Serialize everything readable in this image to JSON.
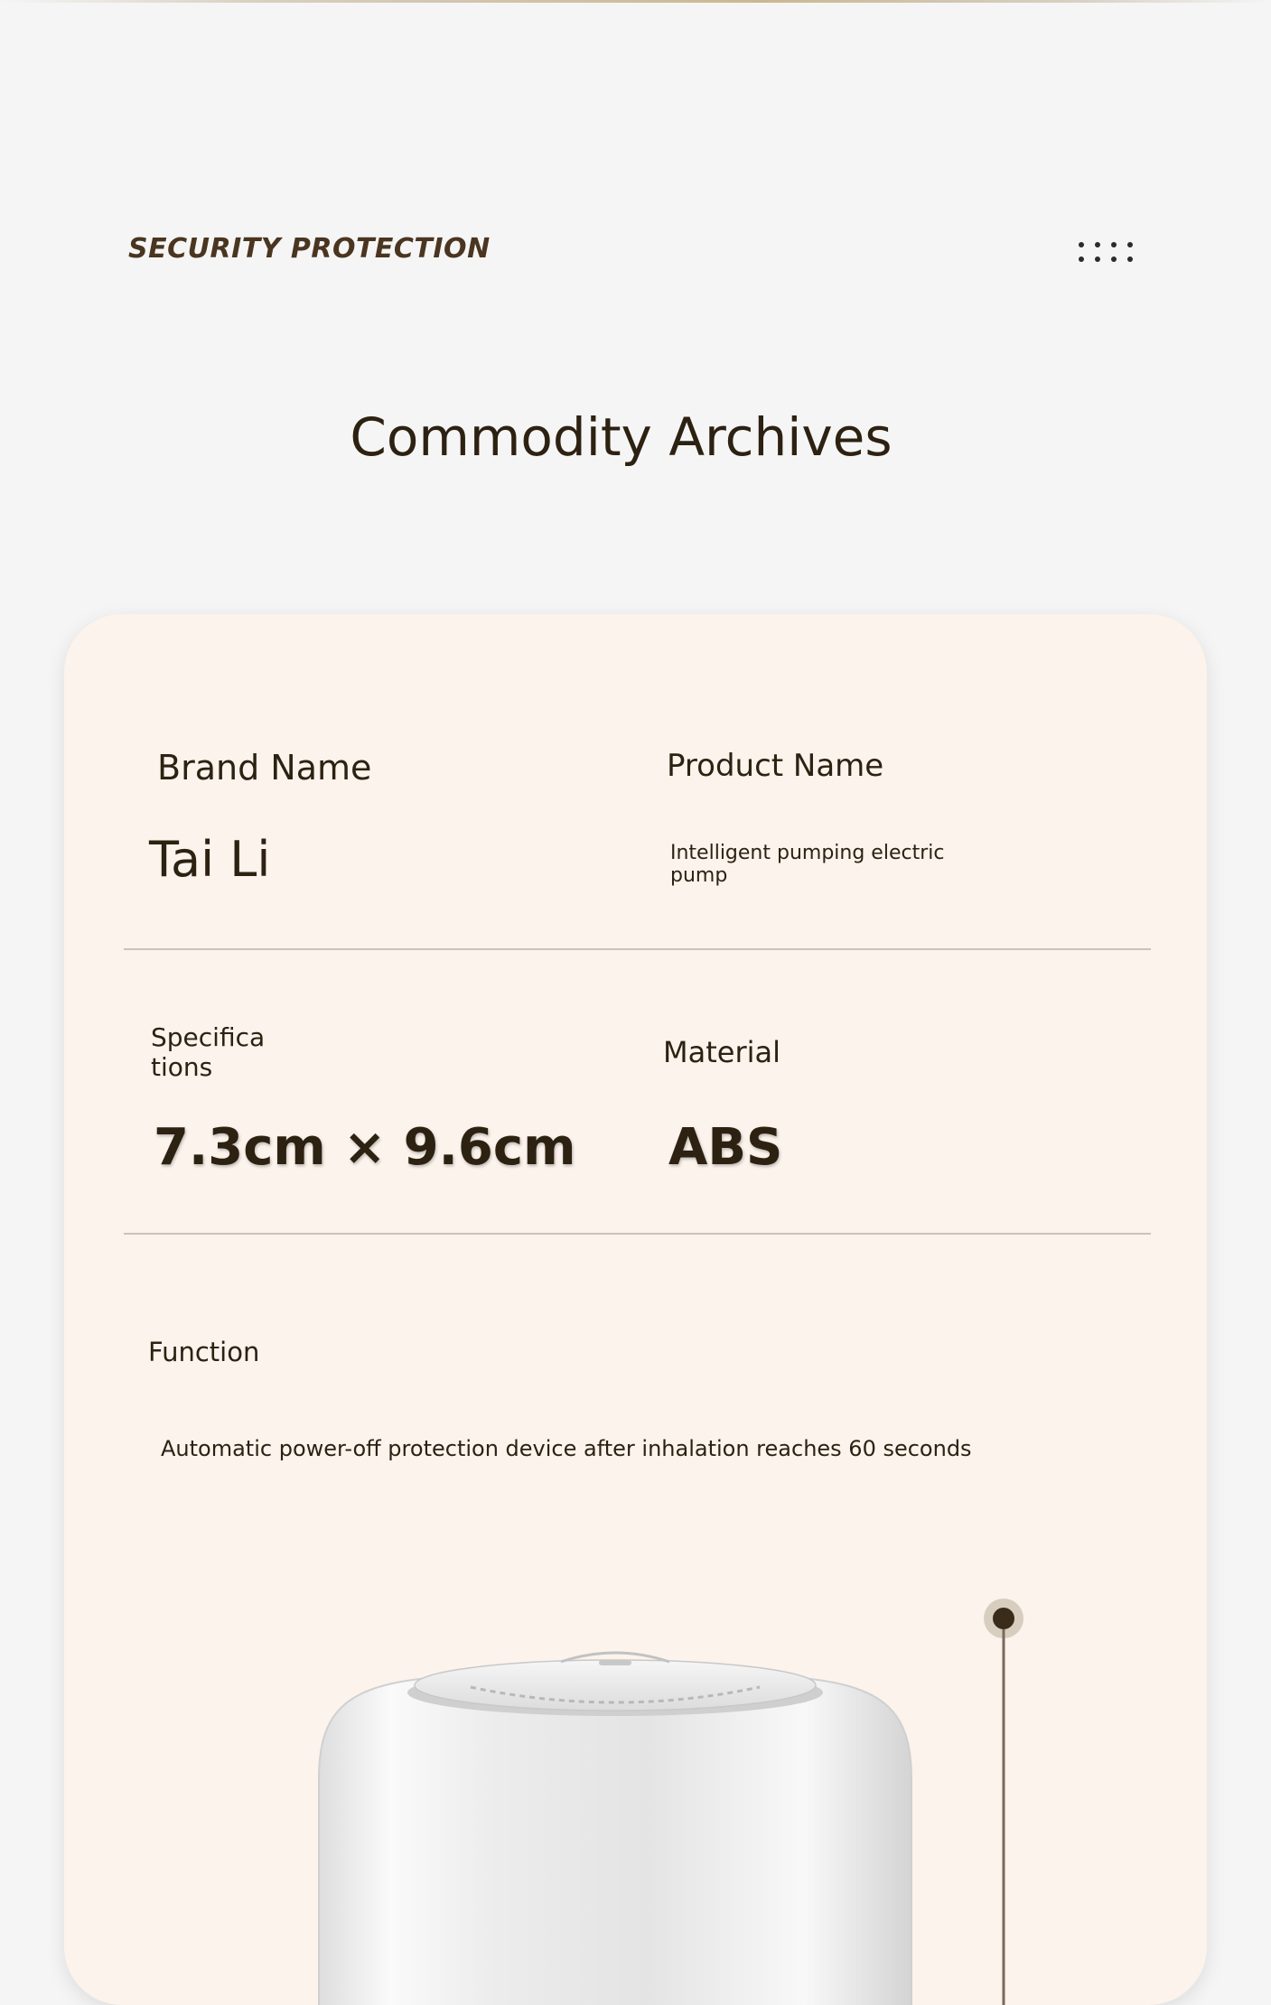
{
  "header": {
    "label": "SECURITY PROTECTION",
    "menu_icon": "dots-grid-icon"
  },
  "page": {
    "title": "Commodity Archives"
  },
  "archive": {
    "brand": {
      "label": "Brand Name",
      "value": "Tai Li"
    },
    "product": {
      "label": "Product Name",
      "value": "Intelligent pumping electric pump"
    },
    "specifications": {
      "label": "Specifica tions",
      "value": "7.3cm × 9.6cm"
    },
    "material": {
      "label": "Material",
      "value": "ABS"
    },
    "function": {
      "label": "Function",
      "value": "Automatic power-off protection device after inhalation reaches 60 seconds"
    }
  },
  "colors": {
    "background": "#f5f5f5",
    "card": "#fbf3ec",
    "text": "#2d2112",
    "accent": "#4a3520"
  }
}
